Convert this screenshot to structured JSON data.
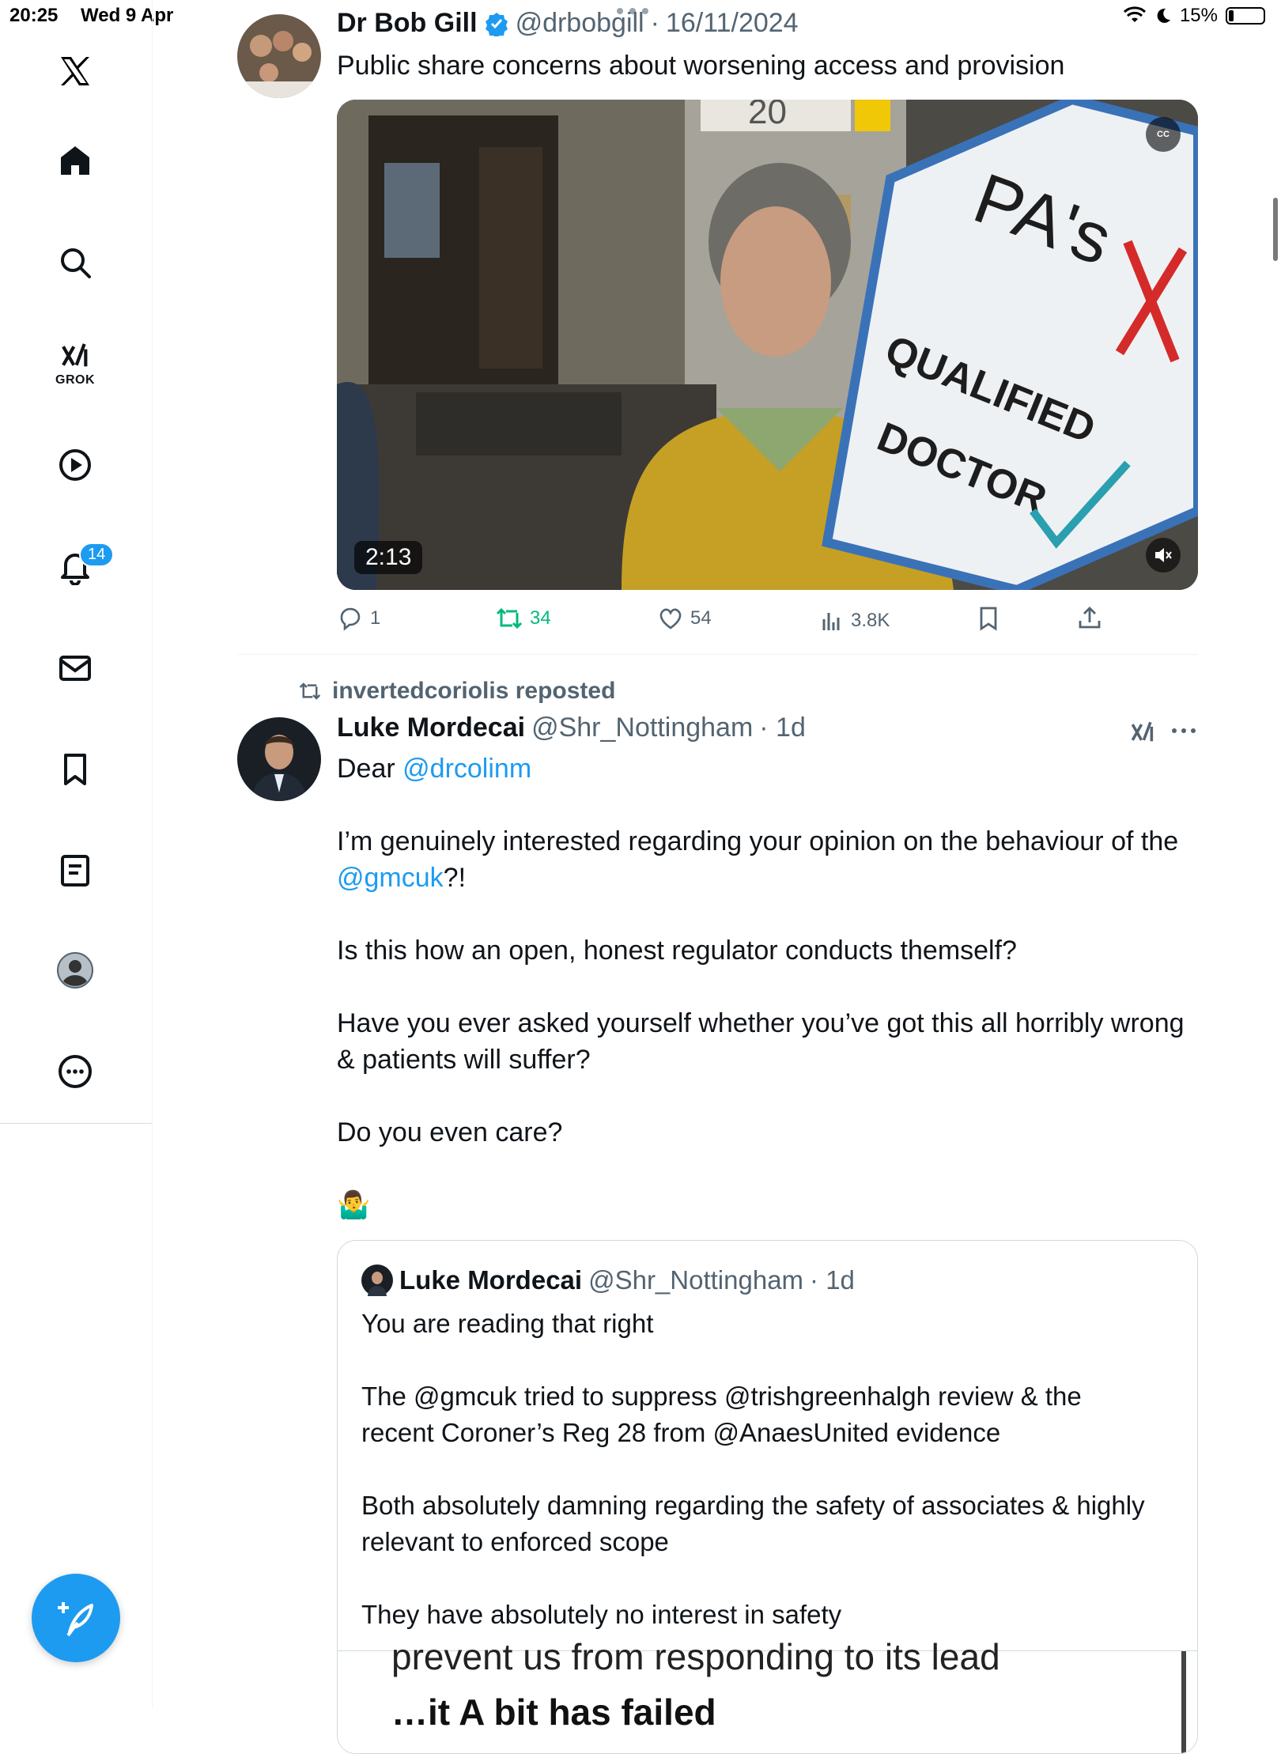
{
  "status_bar": {
    "time": "20:25",
    "date": "Wed 9 Apr",
    "battery": "15%"
  },
  "sidebar": {
    "grok_label": "GROK",
    "notifications_badge": "14"
  },
  "tweet1": {
    "name": "Dr Bob Gill",
    "handle": "@drbobgill",
    "date": "16/11/2024",
    "text": "Public share concerns about worsening access and provision",
    "video": {
      "duration": "2:13",
      "cc_label": "CC",
      "sign_text_1": "PA's",
      "sign_text_2": "QUALIFIED",
      "sign_text_3": "DOCTOR",
      "building_number": "20"
    },
    "actions": {
      "replies": "1",
      "reposts": "34",
      "likes": "54",
      "views": "3.8K"
    }
  },
  "tweet2": {
    "reposted_by": "invertedcoriolis reposted",
    "name": "Luke Mordecai",
    "handle": "@Shr_Nottingham",
    "time": "· 1d",
    "text": {
      "line1_prefix": "Dear ",
      "mention1": "@drcolinm",
      "para2": "I’m genuinely interested regarding your opinion on the behaviour of the",
      "mention2": "@gmcuk",
      "para2_suffix": "?!",
      "para3": "Is this how an open, honest regulator conducts themself?",
      "para4_line1": "Have you ever asked yourself whether you’ve got this all horribly wrong",
      "para4_line2": "& patients will suffer?",
      "para5": "Do you even care?",
      "emoji": "🤷‍♂️"
    },
    "quote": {
      "name": "Luke Mordecai",
      "handle": "@Shr_Nottingham",
      "time": "· 1d",
      "line1": "You are reading that right",
      "line2": "The @gmcuk tried to suppress @trishgreenhalgh review & the",
      "line3": "recent Coroner’s Reg 28 from @AnaesUnited evidence",
      "line4": "Both absolutely damning regarding the safety of associates & highly",
      "line5": "relevant to enforced scope",
      "line6": "They have absolutely no interest in safety",
      "image_text_1": "prevent us from responding to its lead",
      "image_text_2": "…it         A  bit  has  failed"
    }
  },
  "colors": {
    "accent": "#1d9bf0",
    "repost_green": "#00ba7c",
    "text_primary": "#0f1419",
    "text_secondary": "#536471"
  }
}
